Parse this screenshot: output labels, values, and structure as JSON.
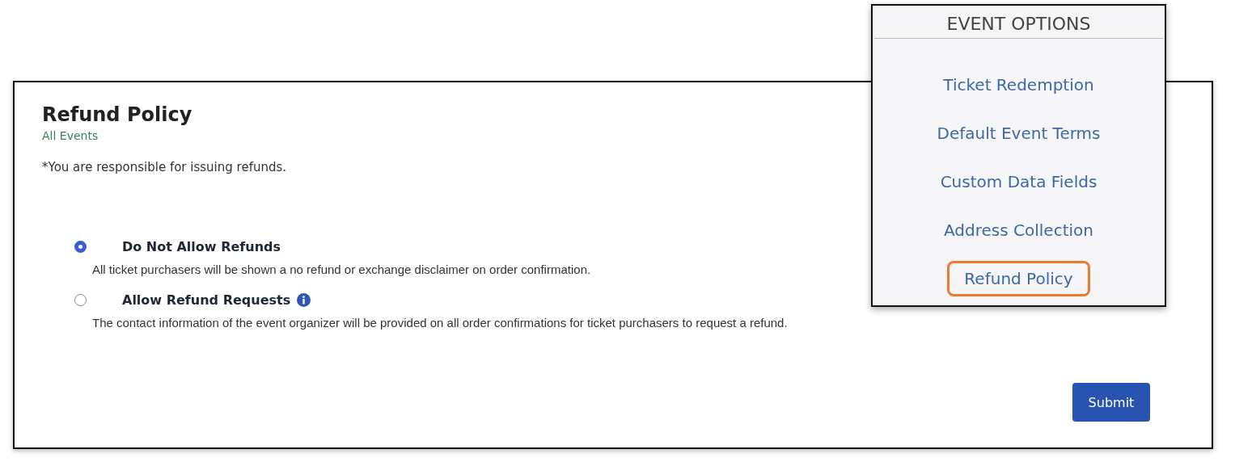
{
  "panel": {
    "title": "Refund Policy",
    "subtitle": "All Events",
    "note": "*You are responsible for issuing refunds.",
    "options": [
      {
        "label": "Do Not Allow Refunds",
        "description": "All ticket purchasers will be shown a no refund or exchange disclaimer on order confirmation.",
        "selected": true,
        "info": false
      },
      {
        "label": "Allow Refund Requests",
        "description": "The contact information of the event organizer will be provided on all order confirmations for ticket purchasers to request a refund.",
        "selected": false,
        "info": true
      }
    ],
    "submit": "Submit"
  },
  "menu": {
    "title": "EVENT OPTIONS",
    "items": [
      {
        "label": "Ticket Redemption",
        "selected": false
      },
      {
        "label": "Default Event Terms",
        "selected": false
      },
      {
        "label": "Custom Data Fields",
        "selected": false
      },
      {
        "label": "Address Collection",
        "selected": false
      },
      {
        "label": "Refund Policy",
        "selected": true
      }
    ]
  }
}
